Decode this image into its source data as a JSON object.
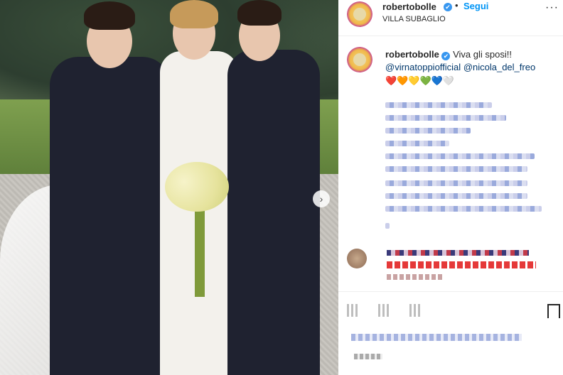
{
  "post": {
    "username": "robertobolle",
    "follow_label": "Segui",
    "location": "VILLA SUBAGLIO",
    "more_label": "···"
  },
  "caption": {
    "username": "robertobolle",
    "text": "Viva gli sposi!!",
    "mention1": "@virnatoppiofficial",
    "mention2": "@nicola_del_freo",
    "hearts": "❤️🧡💛💚💙🤍"
  },
  "photo": {
    "next_label": "›"
  },
  "verified_mark": "✔"
}
